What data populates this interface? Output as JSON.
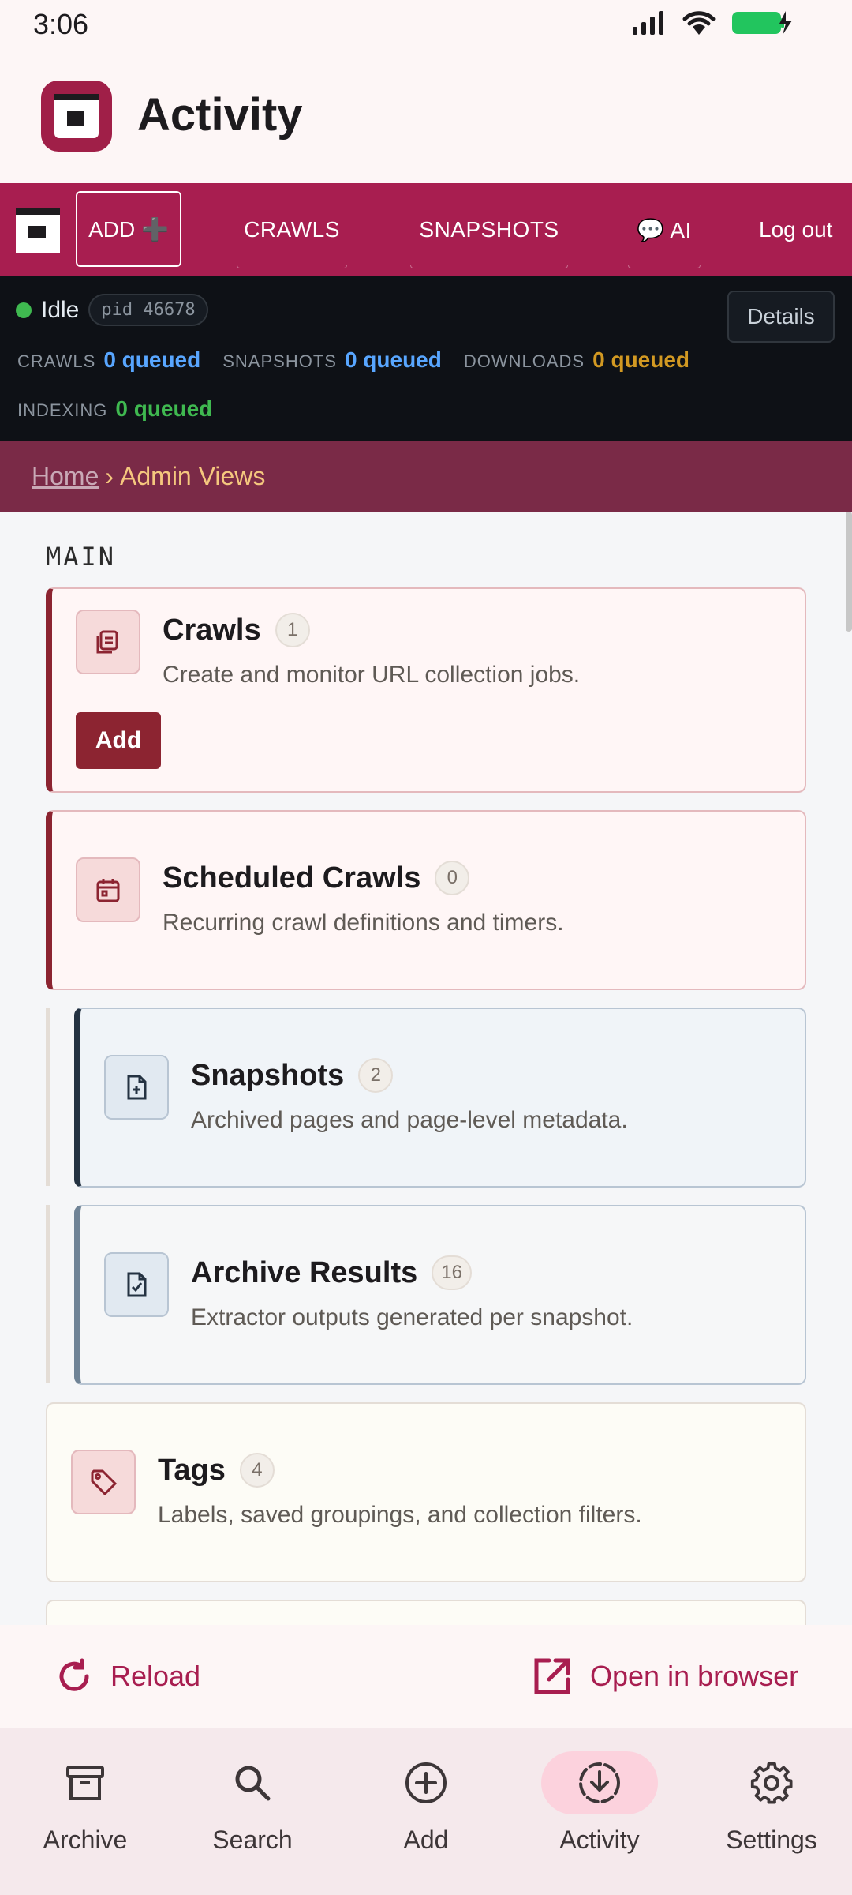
{
  "status_bar": {
    "time": "3:06"
  },
  "app_bar": {
    "title": "Activity"
  },
  "web_nav": {
    "add_label": "ADD ➕",
    "links": [
      "CRAWLS",
      "SNAPSHOTS",
      "💬 AI"
    ],
    "logout": "Log out"
  },
  "orchestrator": {
    "state": "Idle",
    "pid": "pid 46678",
    "details": "Details",
    "queues": [
      {
        "label": "CRAWLS",
        "value": "0 queued",
        "color": "#58a6ff"
      },
      {
        "label": "SNAPSHOTS",
        "value": "0 queued",
        "color": "#58a6ff"
      },
      {
        "label": "DOWNLOADS",
        "value": "0 queued",
        "color": "#d29922"
      },
      {
        "label": "INDEXING",
        "value": "0 queued",
        "color": "#3fb950"
      }
    ]
  },
  "breadcrumb": {
    "home": "Home",
    "separator": "›",
    "current": "Admin Views"
  },
  "main": {
    "section": "MAIN",
    "cards": [
      {
        "title": "Crawls",
        "count": "1",
        "desc": "Create and monitor URL collection jobs.",
        "icon": "document-stack-icon",
        "action": "Add"
      },
      {
        "title": "Scheduled Crawls",
        "count": "0",
        "desc": "Recurring crawl definitions and timers.",
        "icon": "calendar-icon"
      },
      {
        "title": "Snapshots",
        "count": "2",
        "desc": "Archived pages and page-level metadata.",
        "icon": "file-plus-icon"
      },
      {
        "title": "Archive Results",
        "count": "16",
        "desc": "Extractor outputs generated per snapshot.",
        "icon": "file-check-icon"
      },
      {
        "title": "Tags",
        "count": "4",
        "desc": "Labels, saved groupings, and collection filters.",
        "icon": "tag-icon"
      }
    ]
  },
  "actions": {
    "reload": "Reload",
    "open": "Open in browser"
  },
  "bottom_nav": {
    "items": [
      {
        "label": "Archive",
        "icon": "archive-box-icon"
      },
      {
        "label": "Search",
        "icon": "search-icon"
      },
      {
        "label": "Add",
        "icon": "add-circle-icon"
      },
      {
        "label": "Activity",
        "icon": "download-activity-icon",
        "active": true
      },
      {
        "label": "Settings",
        "icon": "gear-icon"
      }
    ]
  },
  "colors": {
    "brand": "#a81e50",
    "dark_panel": "#0e1116",
    "breadcrumb_bg": "#7a2a47",
    "active_pill": "#fcd2dd"
  }
}
